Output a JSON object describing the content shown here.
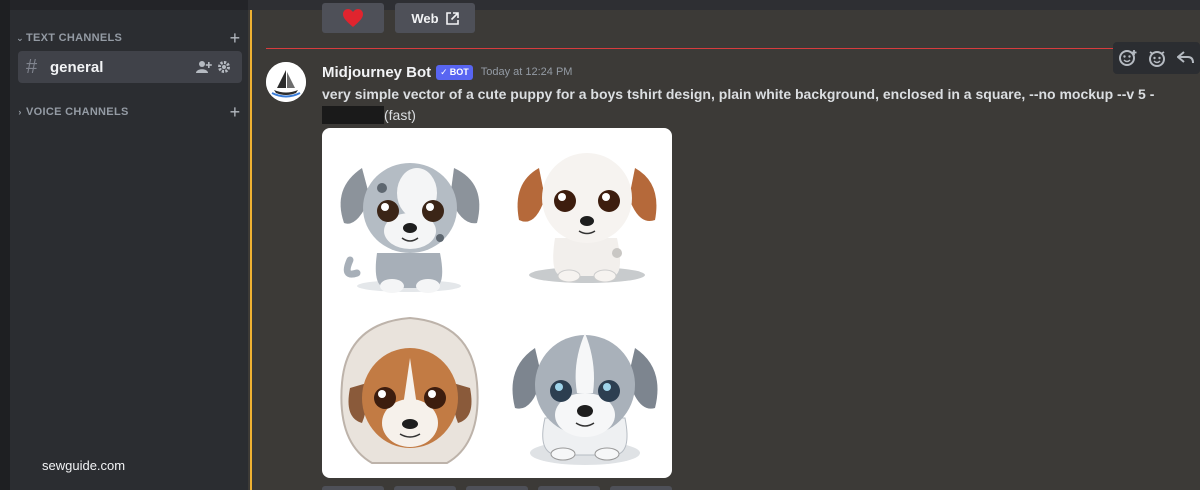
{
  "sidebar": {
    "text_channels_label": "TEXT CHANNELS",
    "voice_channels_label": "VOICE CHANNELS",
    "active_channel": "general"
  },
  "top_buttons": {
    "web_label": "Web"
  },
  "message": {
    "author": "Midjourney Bot",
    "bot_badge": "BOT",
    "timestamp": "Today at 12:24 PM",
    "prompt": "very simple vector of a cute puppy for a boys tshirt design, plain white background, enclosed in a square, --no mockup --v 5 -",
    "speed": "(fast)"
  },
  "images": {
    "cells": [
      {
        "name": "puppy-image-1",
        "fur": "#9aa3ad",
        "ears": "#8a8f96"
      },
      {
        "name": "puppy-image-2",
        "fur": "#f4f1ee",
        "ears": "#b5693a"
      },
      {
        "name": "puppy-image-3",
        "fur": "#c27b44",
        "ears": "#8a5a3a"
      },
      {
        "name": "puppy-image-4",
        "fur": "#a9b1ba",
        "ears": "#7d858f"
      }
    ]
  },
  "watermark": "sewguide.com",
  "colors": {
    "accent": "#5865f2",
    "mention_highlight": "#f0b232",
    "new_divider": "#d83c3e"
  }
}
